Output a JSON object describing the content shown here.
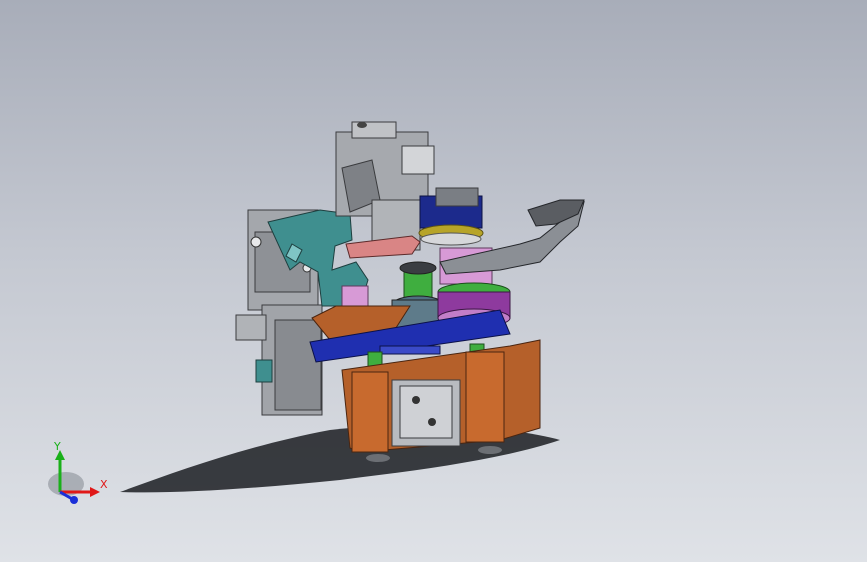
{
  "viewport": {
    "background_top": "#a8adb9",
    "background_bottom": "#dfe2e7"
  },
  "model": {
    "parts": [
      {
        "name": "grey-housing",
        "color": "#9ea1a6"
      },
      {
        "name": "teal-gripper",
        "color": "#3f8f8f"
      },
      {
        "name": "blue-base-plate",
        "color": "#1f2fb0"
      },
      {
        "name": "orange-frame",
        "color": "#b5602a"
      },
      {
        "name": "pink-block",
        "color": "#d79ad6"
      },
      {
        "name": "green-shaft",
        "color": "#3fae3f"
      },
      {
        "name": "salmon-finger",
        "color": "#d98585"
      },
      {
        "name": "navy-cap",
        "color": "#1c2a8c"
      },
      {
        "name": "yellow-ring",
        "color": "#b7a428"
      }
    ]
  },
  "triad": {
    "x_label": "X",
    "y_label": "Y",
    "x_color": "#e01818",
    "y_color": "#19b019",
    "z_color": "#1a2fd8"
  }
}
